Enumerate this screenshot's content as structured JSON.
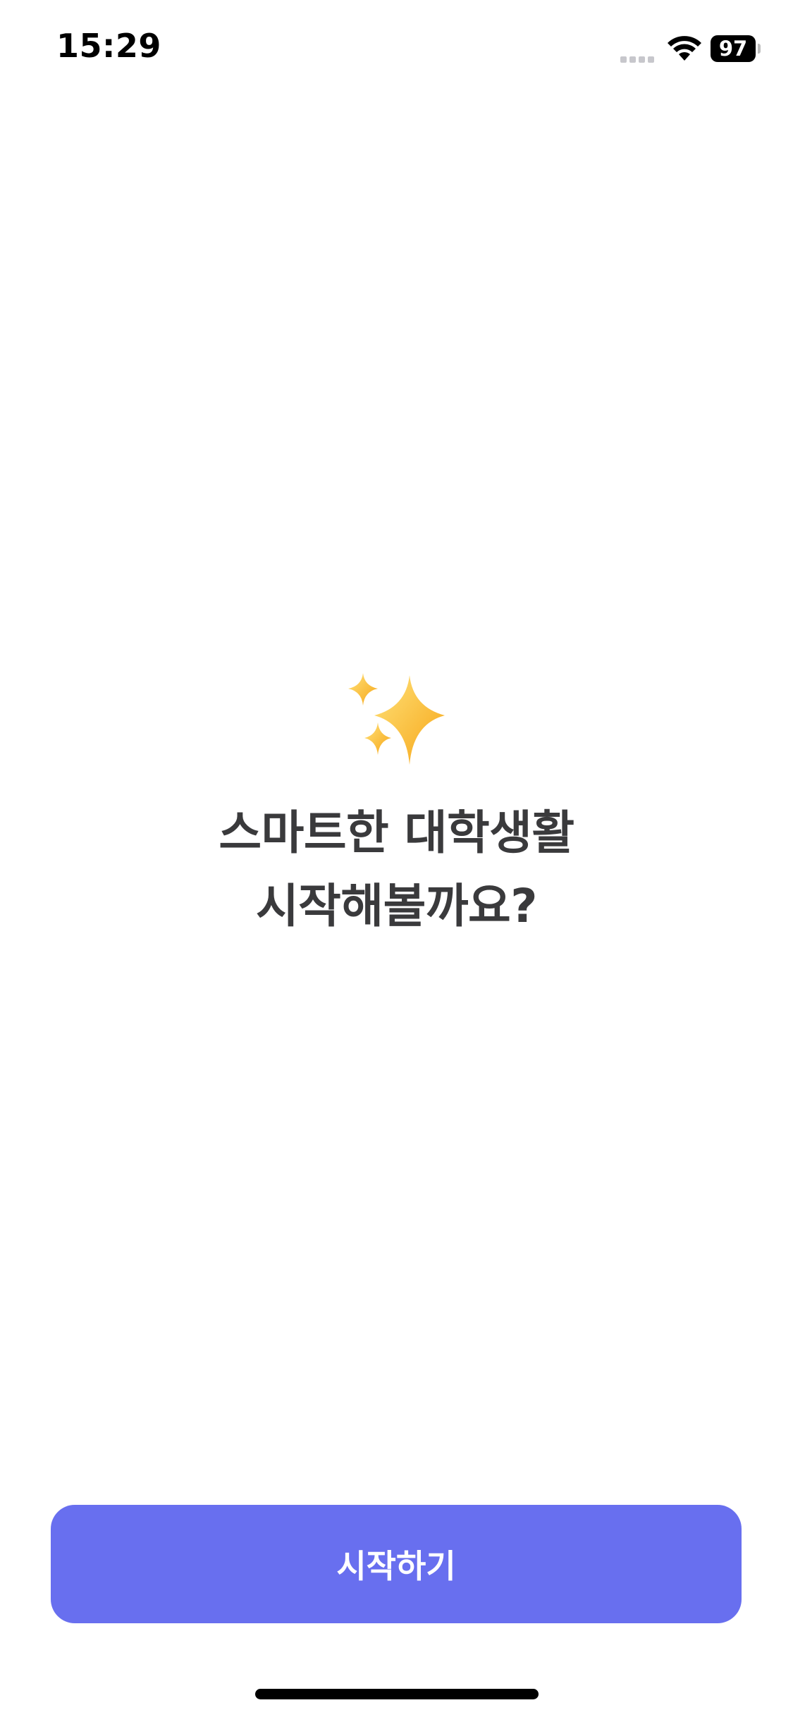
{
  "status_bar": {
    "time": "15:29",
    "battery_level": "97",
    "signal_icon": "cellular-signal-icon",
    "wifi_icon": "wifi-icon",
    "battery_icon": "battery-icon"
  },
  "hero": {
    "icon": "sparkles-icon",
    "title_line_1": "스마트한 대학생활",
    "title_line_2": "시작해볼까요?"
  },
  "actions": {
    "start_label": "시작하기",
    "start_color": "#686FEF"
  },
  "colors": {
    "background": "#FFFFFF",
    "title_text": "#3A3A3C",
    "sparkle": "#FFCB2E"
  }
}
